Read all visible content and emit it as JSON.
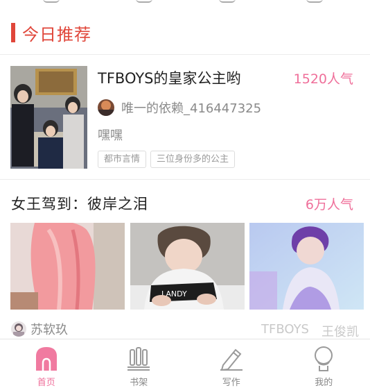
{
  "section": {
    "title": "今日推荐"
  },
  "card1": {
    "title": "TFBOYS的皇家公主哟",
    "popularity": "1520人气",
    "author": "唯一的依赖_416447325",
    "description": "嘿嘿",
    "tags": [
      "都市言情",
      "三位身份多的公主"
    ]
  },
  "card2": {
    "title": "女王驾到：彼岸之泪",
    "popularity": "6万人气",
    "author": "苏软玖",
    "tags": [
      "TFBOYS",
      "王俊凯"
    ]
  },
  "nav": {
    "items": [
      {
        "label": "首页",
        "icon": "home-icon",
        "active": true
      },
      {
        "label": "书架",
        "icon": "bookshelf-icon",
        "active": false
      },
      {
        "label": "写作",
        "icon": "pen-icon",
        "active": false
      },
      {
        "label": "我的",
        "icon": "profile-icon",
        "active": false
      }
    ]
  },
  "colors": {
    "accent": "#e0463a",
    "pink": "#ef6f9a",
    "muted": "#8a8a8a"
  }
}
